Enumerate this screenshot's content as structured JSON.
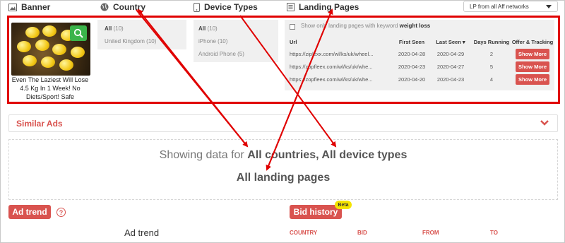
{
  "header": {
    "banner": "Banner",
    "country": "Country",
    "device_types": "Device Types",
    "landing_pages": "Landing Pages",
    "network_select": "LP from all Aff networks"
  },
  "ad": {
    "caption": "Even The Laziest Will Lose 4.5 Kg In 1 Week! No Diets/Sport! Safe"
  },
  "country_panel": [
    {
      "name": "All",
      "count": "(10)"
    },
    {
      "name": "United Kingdom",
      "count": "(10)"
    }
  ],
  "device_panel": [
    {
      "name": "All",
      "count": "(10)"
    },
    {
      "name": "iPhone",
      "count": "(10)"
    },
    {
      "name": "Android Phone",
      "count": "(5)"
    }
  ],
  "landing": {
    "keyword_prefix": "Show only landing pages with keyword",
    "keyword": "weight loss",
    "columns": [
      "Url",
      "First Seen",
      "Last Seen",
      "Days Running",
      "Offer & Tracking"
    ],
    "rows": [
      {
        "url": "https://ziplexx.com/wl/ks/uk/wheel...",
        "first": "2020-04-28",
        "last": "2020-04-29",
        "days": "2",
        "action": "Show More"
      },
      {
        "url": "https://zopfleex.com/wl/ks/uk/whe...",
        "first": "2020-04-23",
        "last": "2020-04-27",
        "days": "5",
        "action": "Show More"
      },
      {
        "url": "https://zopfleex.com/wl/ks/uk/whe...",
        "first": "2020-04-20",
        "last": "2020-04-23",
        "days": "4",
        "action": "Show More"
      }
    ]
  },
  "similar_ads": "Similar Ads",
  "showing": {
    "prefix": "Showing data for",
    "bold": "All countries, All device types",
    "line2": "All landing pages"
  },
  "ad_trend_button": "Ad trend",
  "info_glyph": "?",
  "bid_history_button": "Bid history",
  "beta_badge": "Beta",
  "ad_trend_title": "Ad trend",
  "bid_columns": [
    "COUNTRY",
    "BID",
    "FROM",
    "TO"
  ],
  "colors": {
    "accent": "#d9534f",
    "annotation": "#e00000",
    "zoom": "#3bb44a",
    "beta": "#f5e400"
  }
}
